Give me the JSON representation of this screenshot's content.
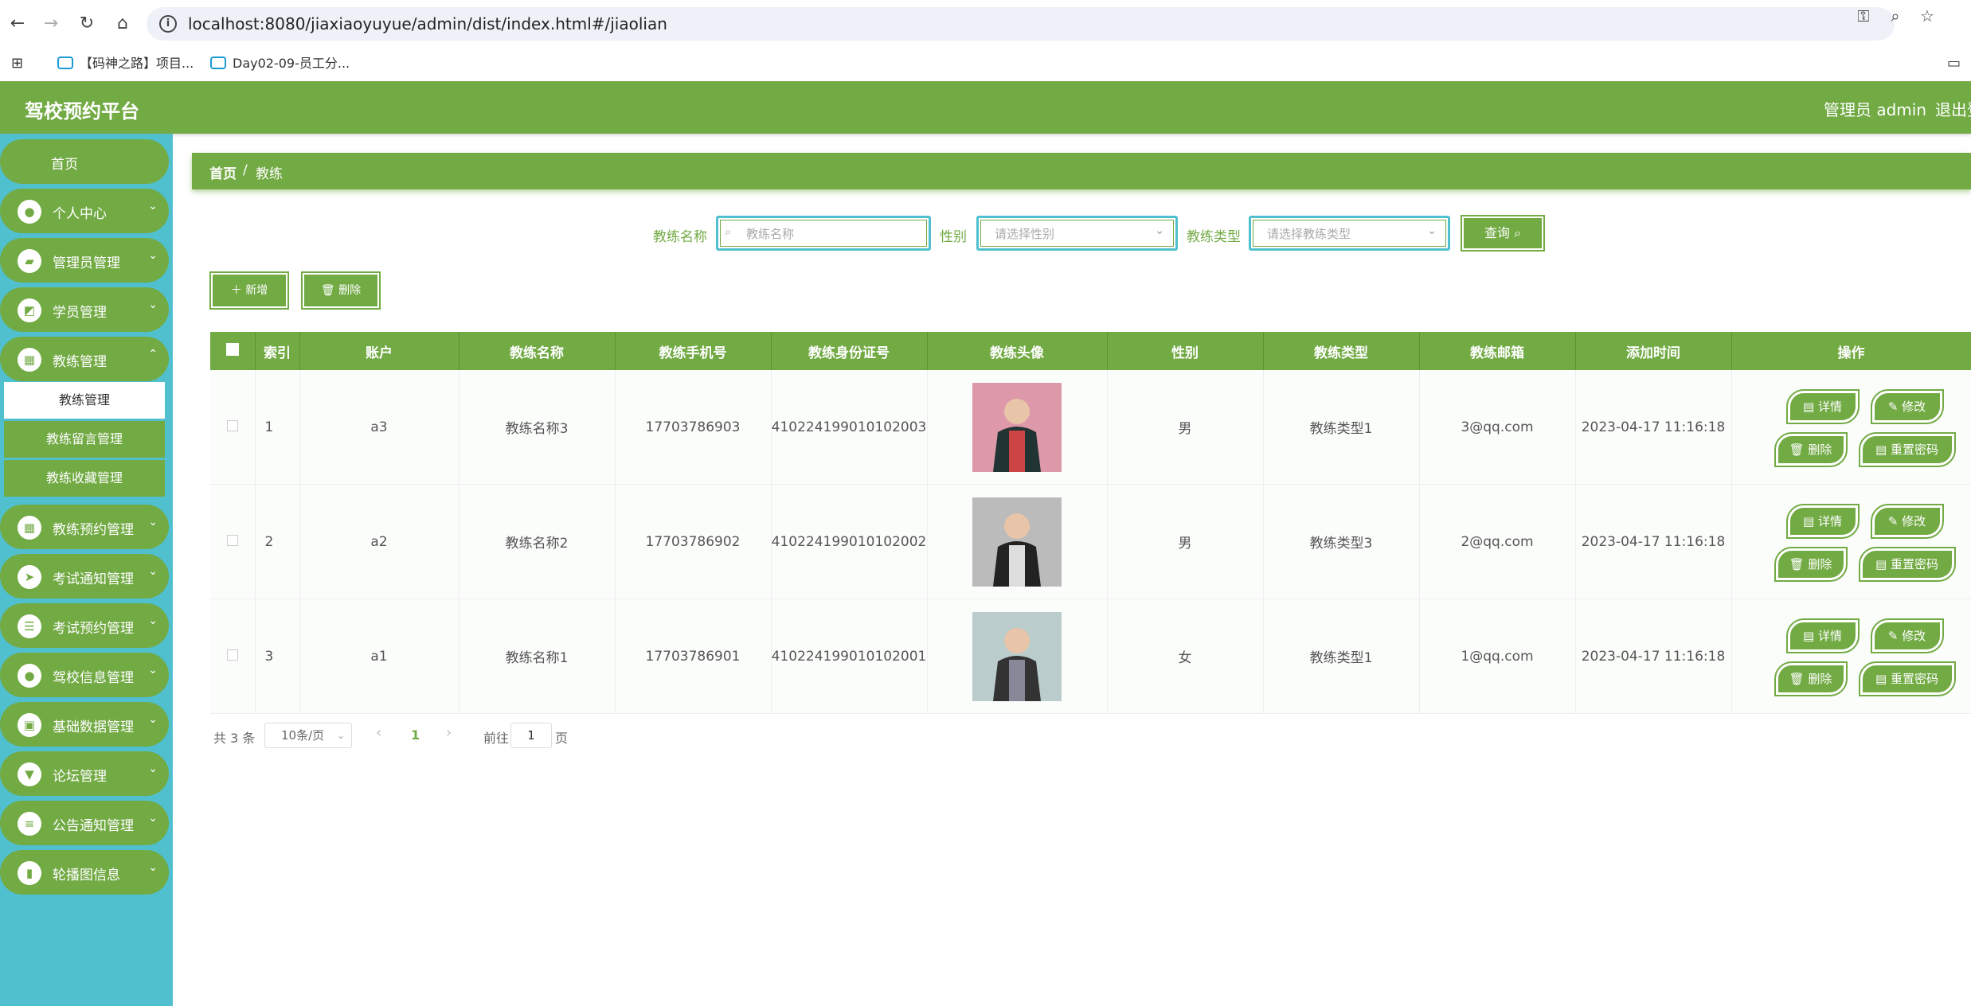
{
  "browser": {
    "url": "localhost:8080/jiaxiaoyuyue/admin/dist/index.html#/jiaolian",
    "bookmarks": [
      "【码神之路】项目...",
      "Day02-09-员工分..."
    ]
  },
  "header": {
    "title": "驾校预约平台",
    "user": "管理员 admin",
    "logout": "退出登录"
  },
  "sidebar": {
    "home": "首页",
    "items": [
      {
        "label": "个人中心",
        "icon": "user-icon"
      },
      {
        "label": "管理员管理",
        "icon": "wallet-icon"
      },
      {
        "label": "学员管理",
        "icon": "chart-icon"
      },
      {
        "label": "教练管理",
        "icon": "grid-icon"
      },
      {
        "label": "教练预约管理",
        "icon": "grid-icon"
      },
      {
        "label": "考试通知管理",
        "icon": "send-icon"
      },
      {
        "label": "考试预约管理",
        "icon": "list-icon"
      },
      {
        "label": "驾校信息管理",
        "icon": "user-icon"
      },
      {
        "label": "基础数据管理",
        "icon": "briefcase-icon"
      },
      {
        "label": "论坛管理",
        "icon": "podium-icon"
      },
      {
        "label": "公告通知管理",
        "icon": "sliders-icon"
      },
      {
        "label": "轮播图信息",
        "icon": "book-icon"
      }
    ],
    "subitems": [
      "教练管理",
      "教练留言管理",
      "教练收藏管理"
    ]
  },
  "breadcrumb": {
    "home": "首页",
    "sep": "/",
    "current": "教练"
  },
  "search": {
    "name_label": "教练名称",
    "name_placeholder": "教练名称",
    "gender_label": "性别",
    "gender_placeholder": "请选择性别",
    "type_label": "教练类型",
    "type_placeholder": "请选择教练类型",
    "query_button": "查询"
  },
  "actions": {
    "add": "新增",
    "delete": "删除"
  },
  "table": {
    "headers": [
      "索引",
      "账户",
      "教练名称",
      "教练手机号",
      "教练身份证号",
      "教练头像",
      "性别",
      "教练类型",
      "教练邮箱",
      "添加时间",
      "操作"
    ],
    "rows": [
      {
        "index": "1",
        "account": "a3",
        "name": "教练名称3",
        "phone": "17703786903",
        "idcard": "410224199010102003",
        "gender": "男",
        "type": "教练类型1",
        "email": "3@qq.com",
        "time": "2023-04-17 11:16:18"
      },
      {
        "index": "2",
        "account": "a2",
        "name": "教练名称2",
        "phone": "17703786902",
        "idcard": "410224199010102002",
        "gender": "男",
        "type": "教练类型3",
        "email": "2@qq.com",
        "time": "2023-04-17 11:16:18"
      },
      {
        "index": "3",
        "account": "a1",
        "name": "教练名称1",
        "phone": "17703786901",
        "idcard": "410224199010102001",
        "gender": "女",
        "type": "教练类型1",
        "email": "1@qq.com",
        "time": "2023-04-17 11:16:18"
      }
    ],
    "ops": {
      "detail": "详情",
      "edit": "修改",
      "delete": "删除",
      "reset": "重置密码"
    }
  },
  "pager": {
    "total": "共 3 条",
    "size": "10条/页",
    "current": "1",
    "goto": "前往",
    "page_input": "1",
    "page_unit": "页"
  },
  "colors": {
    "primary": "#72aa44",
    "sidebar": "#50c0cf"
  }
}
